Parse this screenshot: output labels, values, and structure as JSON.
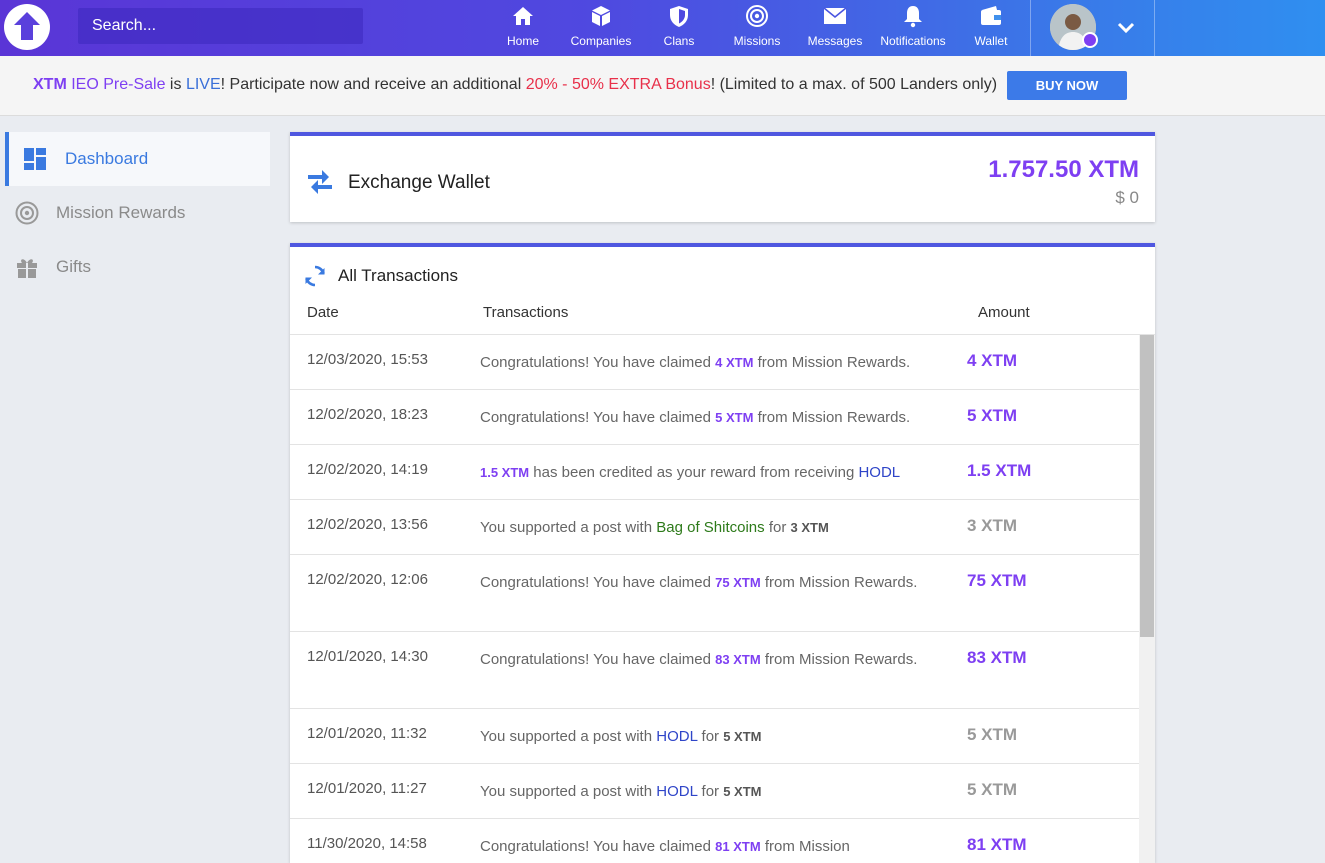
{
  "search": {
    "placeholder": "Search..."
  },
  "nav": [
    {
      "label": "Home",
      "icon": "home-icon"
    },
    {
      "label": "Companies",
      "icon": "box-icon"
    },
    {
      "label": "Clans",
      "icon": "shield-icon"
    },
    {
      "label": "Missions",
      "icon": "target-icon"
    },
    {
      "label": "Messages",
      "icon": "envelope-icon"
    },
    {
      "label": "Notifications",
      "icon": "bell-icon"
    },
    {
      "label": "Wallet",
      "icon": "wallet-icon"
    }
  ],
  "announcement": {
    "p1": "XTM",
    "p2": " IEO Pre-Sale",
    "p3": " is ",
    "p4": "LIVE",
    "p5": "! Participate now and receive an additional ",
    "p6": "20% - 50% EXTRA Bonus",
    "p7": "! (Limited to a max. of 500 Landers only)",
    "button": "BUY NOW"
  },
  "sidebar": {
    "items": [
      {
        "label": "Dashboard",
        "icon": "dashboard-icon",
        "active": true
      },
      {
        "label": "Mission Rewards",
        "icon": "target-icon",
        "active": false
      },
      {
        "label": "Gifts",
        "icon": "gift-icon",
        "active": false
      }
    ]
  },
  "wallet": {
    "title": "Exchange Wallet",
    "amount": "1.757.50 XTM",
    "usd": "$ 0"
  },
  "transactions": {
    "title": "All Transactions",
    "columns": {
      "date": "Date",
      "transactions": "Transactions",
      "amount": "Amount"
    },
    "rows": [
      {
        "date": "12/03/2020, 15:53",
        "amount": "4 XTM",
        "amount_color": "purple",
        "parts": [
          {
            "t": "Congratulations! You have claimed "
          },
          {
            "t": "4 XTM",
            "s": "xtm-p"
          },
          {
            "t": " from Mission Rewards."
          }
        ]
      },
      {
        "date": "12/02/2020, 18:23",
        "amount": "5 XTM",
        "amount_color": "purple",
        "parts": [
          {
            "t": "Congratulations! You have claimed "
          },
          {
            "t": "5 XTM",
            "s": "xtm-p"
          },
          {
            "t": " from Mission Rewards."
          }
        ]
      },
      {
        "date": "12/02/2020, 14:19",
        "amount": "1.5 XTM",
        "amount_color": "purple",
        "parts": [
          {
            "t": "1.5 XTM",
            "s": "xtm-p"
          },
          {
            "t": " has been credited as your reward from receiving "
          },
          {
            "t": "HODL",
            "s": "lnk-blue"
          }
        ]
      },
      {
        "date": "12/02/2020, 13:56",
        "amount": "3 XTM",
        "amount_color": "gray",
        "parts": [
          {
            "t": "You supported a post with "
          },
          {
            "t": "Bag of Shitcoins",
            "s": "lnk-green"
          },
          {
            "t": " for "
          },
          {
            "t": "3 XTM",
            "s": "xtm-g"
          }
        ]
      },
      {
        "date": "12/02/2020, 12:06",
        "amount": "75 XTM",
        "amount_color": "purple",
        "parts": [
          {
            "t": "Congratulations! You have claimed "
          },
          {
            "t": "75 XTM",
            "s": "xtm-p"
          },
          {
            "t": " from Mission Rewards."
          }
        ]
      },
      {
        "date": "12/01/2020, 14:30",
        "amount": "83 XTM",
        "amount_color": "purple",
        "parts": [
          {
            "t": "Congratulations! You have claimed "
          },
          {
            "t": "83 XTM",
            "s": "xtm-p"
          },
          {
            "t": " from Mission Rewards."
          }
        ]
      },
      {
        "date": "12/01/2020, 11:32",
        "amount": "5 XTM",
        "amount_color": "gray",
        "parts": [
          {
            "t": "You supported a post with "
          },
          {
            "t": "HODL",
            "s": "lnk-blue"
          },
          {
            "t": " for "
          },
          {
            "t": "5 XTM",
            "s": "xtm-g"
          }
        ]
      },
      {
        "date": "12/01/2020, 11:27",
        "amount": "5 XTM",
        "amount_color": "gray",
        "parts": [
          {
            "t": "You supported a post with "
          },
          {
            "t": "HODL",
            "s": "lnk-blue"
          },
          {
            "t": " for "
          },
          {
            "t": "5 XTM",
            "s": "xtm-g"
          }
        ]
      },
      {
        "date": "11/30/2020, 14:58",
        "amount": "81 XTM",
        "amount_color": "purple",
        "parts": [
          {
            "t": "Congratulations! You have claimed "
          },
          {
            "t": "81 XTM",
            "s": "xtm-p"
          },
          {
            "t": " from Mission"
          }
        ]
      }
    ]
  },
  "colors": {
    "accent": "#7e3ff2",
    "primary": "#3a7ae0"
  }
}
